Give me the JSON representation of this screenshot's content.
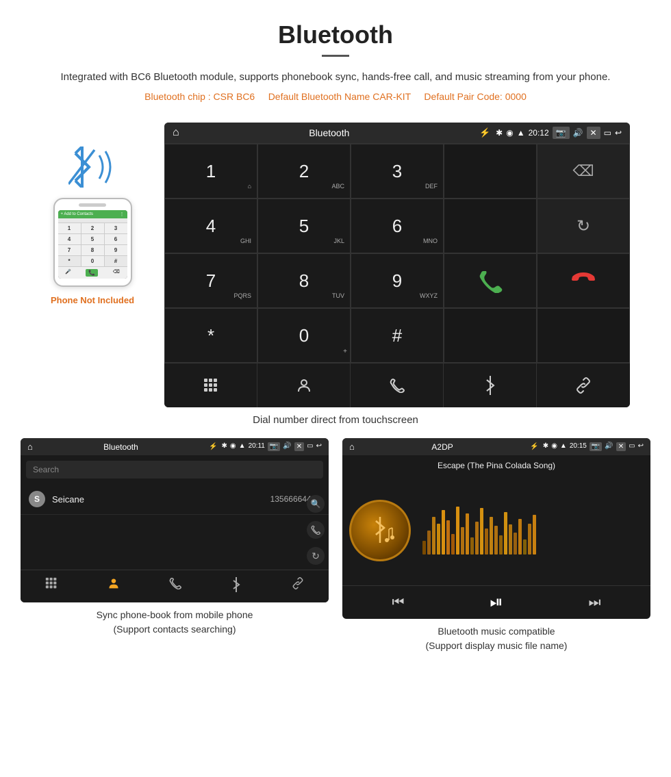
{
  "header": {
    "title": "Bluetooth",
    "description": "Integrated with BC6 Bluetooth module, supports phonebook sync, hands-free call, and music streaming from your phone.",
    "specs": "(Bluetooth chip : CSR BC6    Default Bluetooth Name CAR-KIT    Default Pair Code: 0000)",
    "specs_parts": {
      "chip": "Bluetooth chip : CSR BC6",
      "name": "Default Bluetooth Name CAR-KIT",
      "pair": "Default Pair Code: 0000"
    }
  },
  "phone_label": "Phone Not Included",
  "dial_screen": {
    "title": "Bluetooth",
    "time": "20:12",
    "keys": [
      {
        "num": "1",
        "sub": "⌂"
      },
      {
        "num": "2",
        "sub": "ABC"
      },
      {
        "num": "3",
        "sub": "DEF"
      },
      {
        "num": "",
        "sub": ""
      },
      {
        "num": "⌫",
        "sub": ""
      },
      {
        "num": "4",
        "sub": "GHI"
      },
      {
        "num": "5",
        "sub": "JKL"
      },
      {
        "num": "6",
        "sub": "MNO"
      },
      {
        "num": "",
        "sub": ""
      },
      {
        "num": "↺",
        "sub": ""
      },
      {
        "num": "7",
        "sub": "PQRS"
      },
      {
        "num": "8",
        "sub": "TUV"
      },
      {
        "num": "9",
        "sub": "WXYZ"
      },
      {
        "num": "📞",
        "sub": ""
      },
      {
        "num": "📵",
        "sub": ""
      },
      {
        "num": "*",
        "sub": ""
      },
      {
        "num": "0+",
        "sub": ""
      },
      {
        "num": "#",
        "sub": ""
      },
      {
        "num": "",
        "sub": ""
      },
      {
        "num": "",
        "sub": ""
      }
    ],
    "toolbar": [
      "⊞",
      "👤",
      "☎",
      "✱",
      "🔗"
    ]
  },
  "dial_caption": "Dial number direct from touchscreen",
  "phonebook_screen": {
    "title": "Bluetooth",
    "time": "20:11",
    "search_placeholder": "Search",
    "contact": {
      "letter": "S",
      "name": "Seicane",
      "number": "13566664466"
    },
    "caption_line1": "Sync phone-book from mobile phone",
    "caption_line2": "(Support contacts searching)"
  },
  "music_screen": {
    "title": "A2DP",
    "time": "20:15",
    "song_title": "Escape (The Pina Colada Song)",
    "caption_line1": "Bluetooth music compatible",
    "caption_line2": "(Support display music file name)"
  },
  "colors": {
    "accent_orange": "#e07020",
    "screen_bg": "#1a1a1a",
    "screen_dark": "#2a2a2a",
    "green_call": "#4caf50",
    "red_hangup": "#e53935",
    "bluetooth_blue": "#3b8fd4",
    "gold_music": "#b87a10"
  }
}
